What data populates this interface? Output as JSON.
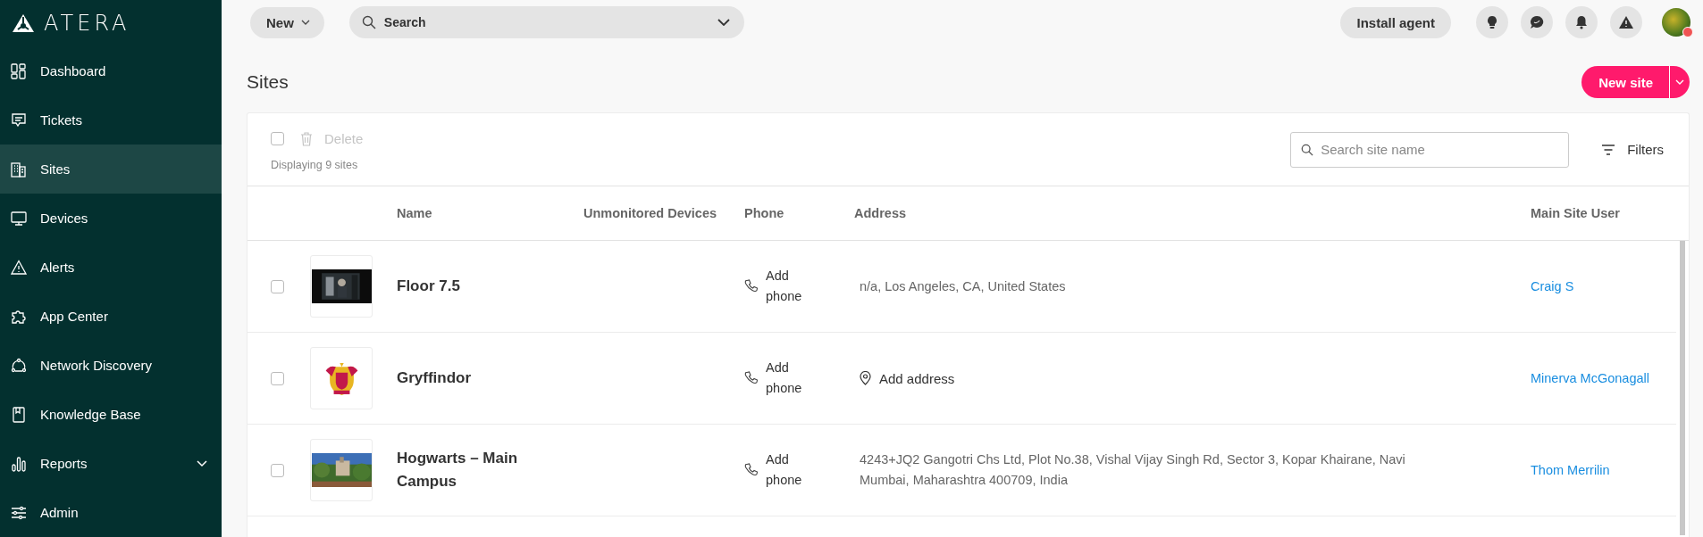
{
  "logo": {
    "text": "ATERA"
  },
  "sidebar": {
    "items": [
      {
        "label": "Dashboard",
        "selected": false,
        "kind": "link"
      },
      {
        "label": "Tickets",
        "selected": false,
        "kind": "link"
      },
      {
        "label": "Sites",
        "selected": true,
        "kind": "link"
      },
      {
        "label": "Devices",
        "selected": false,
        "kind": "link"
      },
      {
        "label": "Alerts",
        "selected": false,
        "kind": "link"
      },
      {
        "label": "App Center",
        "selected": false,
        "kind": "link"
      },
      {
        "label": "Network Discovery",
        "selected": false,
        "kind": "link"
      },
      {
        "label": "Knowledge Base",
        "selected": false,
        "kind": "link"
      },
      {
        "label": "Reports",
        "selected": false,
        "kind": "group"
      },
      {
        "label": "Admin",
        "selected": false,
        "kind": "link"
      }
    ]
  },
  "top_bar": {
    "new_button": "New",
    "search": {
      "placeholder": "Search"
    },
    "install_button": "Install agent"
  },
  "page": {
    "title": "Sites",
    "new_site_button": "New site"
  },
  "toolbar": {
    "select_all": {
      "checked": false
    },
    "delete": {
      "label": "Delete",
      "disabled": true
    },
    "count": "Displaying 9 sites",
    "search": {
      "placeholder": "Search site name"
    },
    "filters": "Filters"
  },
  "table": {
    "columns": [
      "Name",
      "Unmonitored Devices",
      "Phone",
      "Address",
      "Main Site User"
    ],
    "rows": [
      {
        "checked": false,
        "name": "Floor 7.5",
        "phone": "Add phone",
        "address": {
          "kind": "text",
          "text": "n/a, Los Angeles, CA, United States"
        },
        "main_user": "Craig S"
      },
      {
        "checked": false,
        "name": "Gryffindor",
        "phone": "Add phone",
        "address": {
          "kind": "action",
          "text": "Add address"
        },
        "main_user": "Minerva McGonagall"
      },
      {
        "checked": false,
        "name": "Hogwarts – Main Campus",
        "phone": "Add phone",
        "address": {
          "kind": "text",
          "text": "4243+JQ2 Gangotri Chs Ltd, Plot No.38, Vishal Vijay Singh Rd, Sector 3, Kopar Khairane, Navi Mumbai, Maharashtra 400709, India"
        },
        "main_user": "Thom Merrilin"
      }
    ]
  }
}
